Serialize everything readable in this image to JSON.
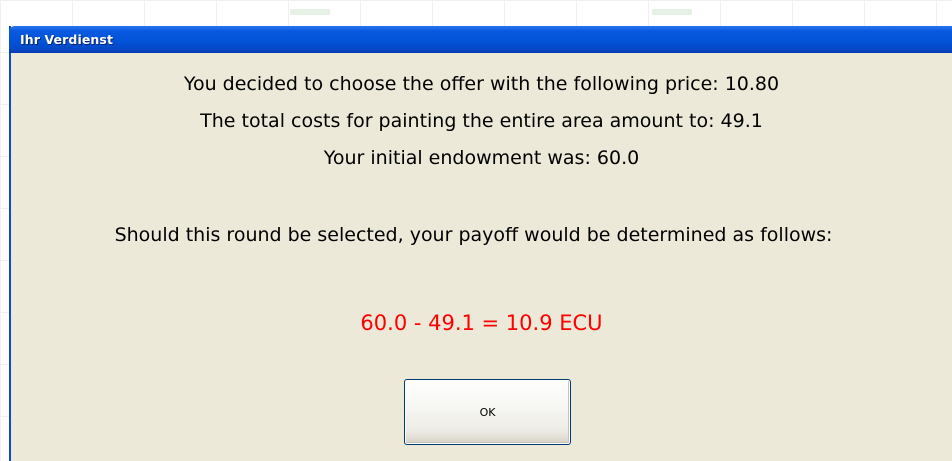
{
  "dialog": {
    "title": "Ihr Verdienst",
    "lines": [
      "You decided to choose the offer with the following price:  10.80",
      "The total costs for painting the entire area amount to:  49.1",
      "Your initial endowment was:  60.0",
      "Should this round be selected, your payoff would be determined as follows:"
    ],
    "result": "60.0 - 49.1 = 10.9 ECU",
    "ok_label": "OK"
  },
  "colors": {
    "titlebar": "#0353d8",
    "dialog_background": "#ece9d8",
    "result_text": "#ff0000"
  }
}
